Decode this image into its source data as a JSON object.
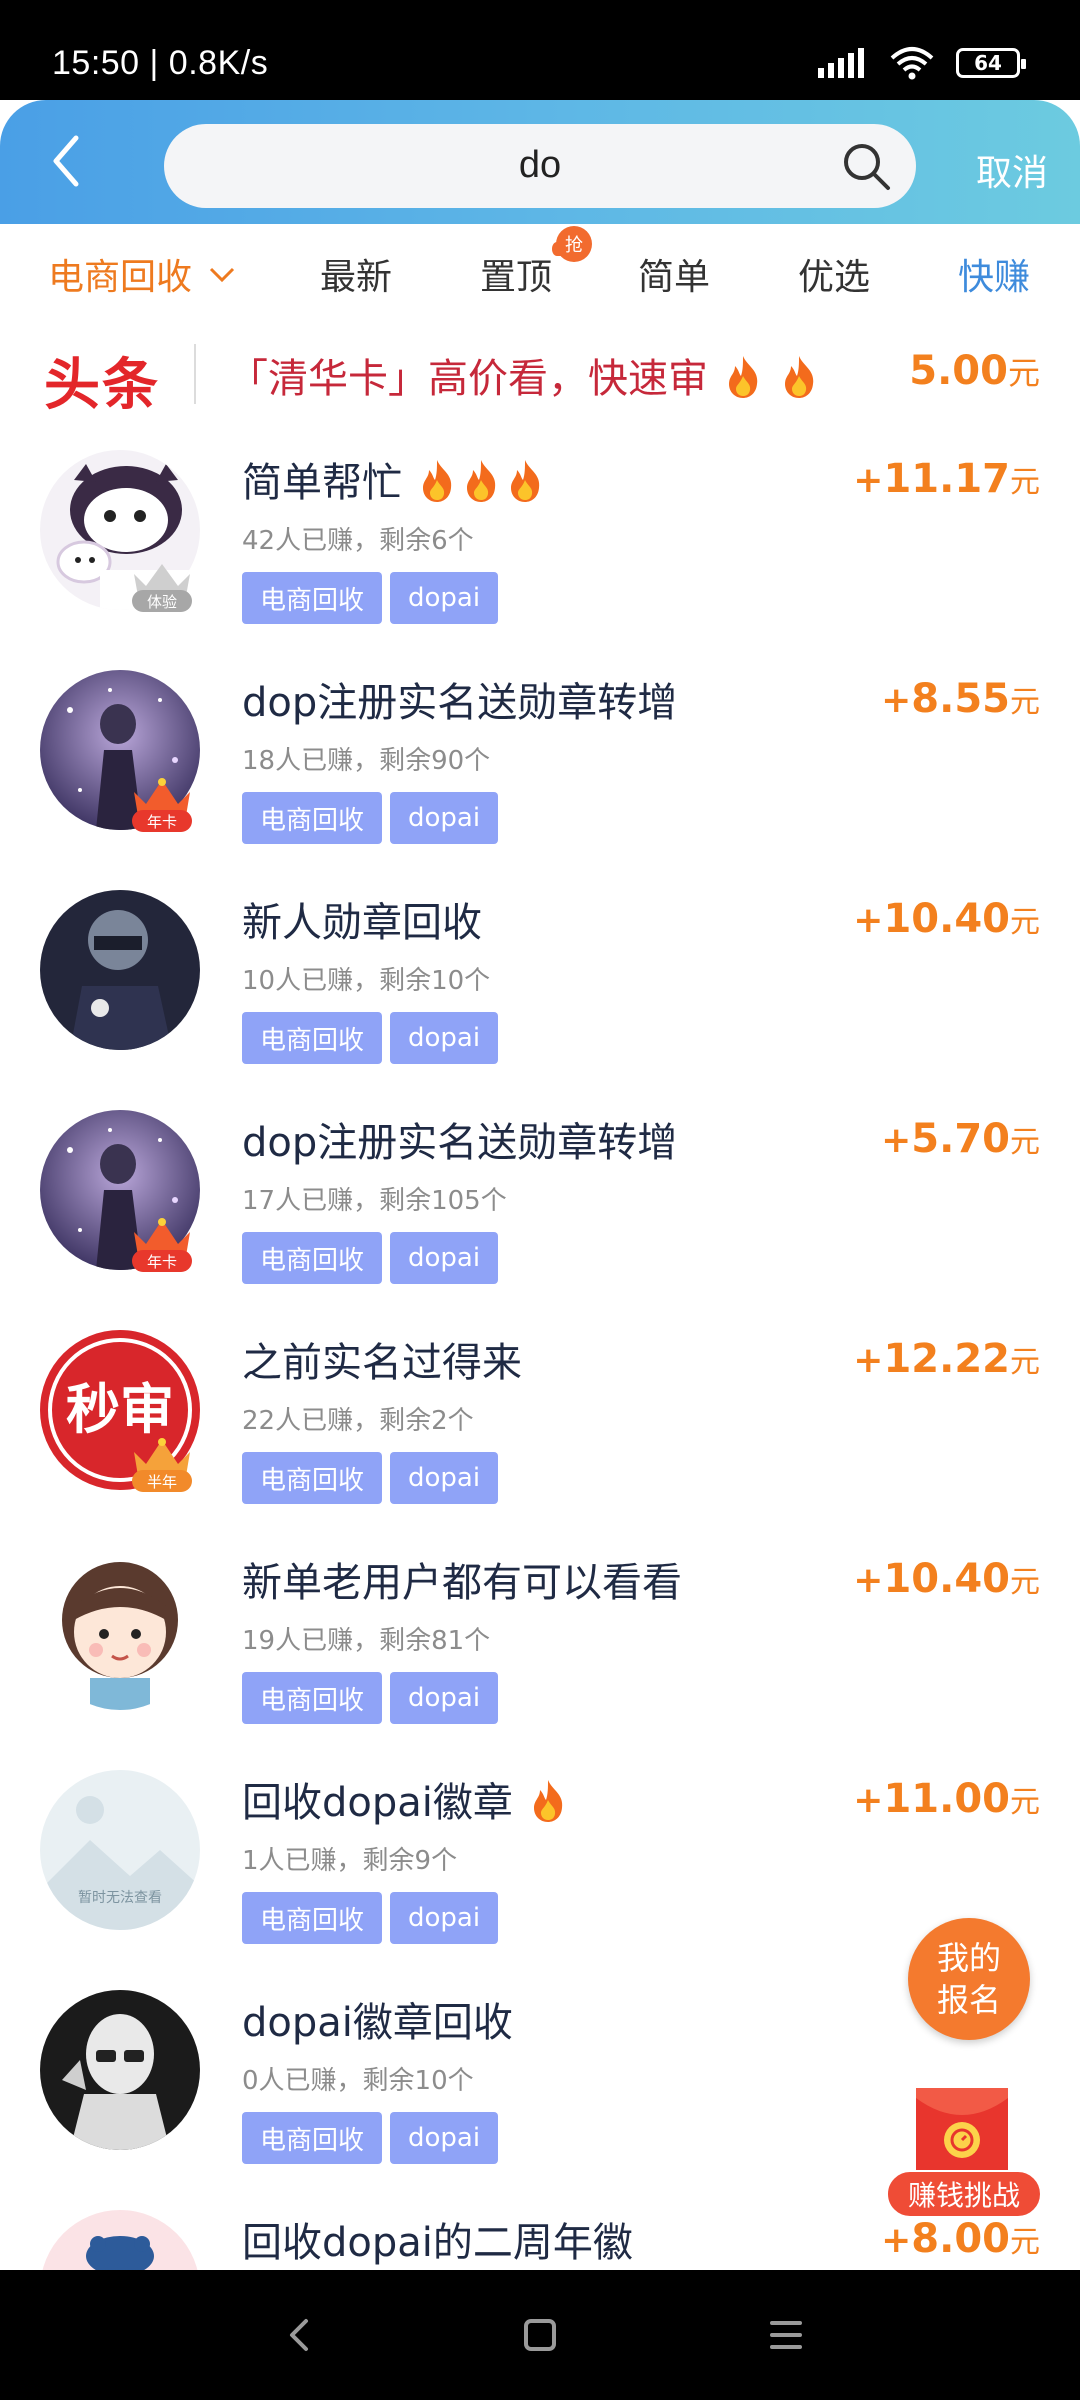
{
  "status_bar": {
    "time": "15:50 | 0.8K/s",
    "battery": "64"
  },
  "header": {
    "search_value": "do",
    "cancel_label": "取消"
  },
  "tabs": [
    {
      "label": "电商回收"
    },
    {
      "label": "最新"
    },
    {
      "label": "置顶",
      "badge": "抢"
    },
    {
      "label": "简单"
    },
    {
      "label": "优选"
    },
    {
      "label": "快赚"
    }
  ],
  "headline": {
    "logo": "头条",
    "text": "「清华卡」高价看，快速审",
    "amount": "5.00",
    "unit": "元"
  },
  "items": [
    {
      "title": "简单帮忙",
      "fires": 3,
      "meta": "42人已赚，剩余6个",
      "price": "11.17",
      "badge": "体验",
      "tags": [
        "电商回收",
        "dopai"
      ]
    },
    {
      "title": "dop注册实名送勋章转增",
      "fires": 0,
      "meta": "18人已赚，剩余90个",
      "price": "8.55",
      "badge": "年卡",
      "tags": [
        "电商回收",
        "dopai"
      ]
    },
    {
      "title": "新人勋章回收",
      "fires": 0,
      "meta": "10人已赚，剩余10个",
      "price": "10.40",
      "badge": "",
      "tags": [
        "电商回收",
        "dopai"
      ]
    },
    {
      "title": "dop注册实名送勋章转增",
      "fires": 0,
      "meta": "17人已赚，剩余105个",
      "price": "5.70",
      "badge": "年卡",
      "tags": [
        "电商回收",
        "dopai"
      ]
    },
    {
      "title": "之前实名过得来",
      "fires": 0,
      "meta": "22人已赚，剩余2个",
      "price": "12.22",
      "badge": "半年",
      "avatar_text": "秒审",
      "tags": [
        "电商回收",
        "dopai"
      ]
    },
    {
      "title": "新单老用户都有可以看看",
      "fires": 0,
      "meta": "19人已赚，剩余81个",
      "price": "10.40",
      "badge": "",
      "tags": [
        "电商回收",
        "dopai"
      ]
    },
    {
      "title": "回收dopai徽章",
      "fires": 1,
      "meta": "1人已赚，剩余9个",
      "price": "11.00",
      "badge": "",
      "avatar_text": "暂时无法查看",
      "tags": [
        "电商回收",
        "dopai"
      ]
    },
    {
      "title": "dopai徽章回收",
      "fires": 0,
      "meta": "0人已赚，剩余10个",
      "price": "",
      "badge": "",
      "tags": [
        "电商回收",
        "dopai"
      ]
    },
    {
      "title": "回收dopai的二周年徽",
      "fires": 0,
      "meta": "",
      "price": "8.00",
      "badge": "",
      "tags": []
    }
  ],
  "price_prefix": "+",
  "price_unit": "元",
  "floating": {
    "apply_line1": "我的",
    "apply_line2": "报名",
    "challenge_label": "赚钱挑战"
  }
}
